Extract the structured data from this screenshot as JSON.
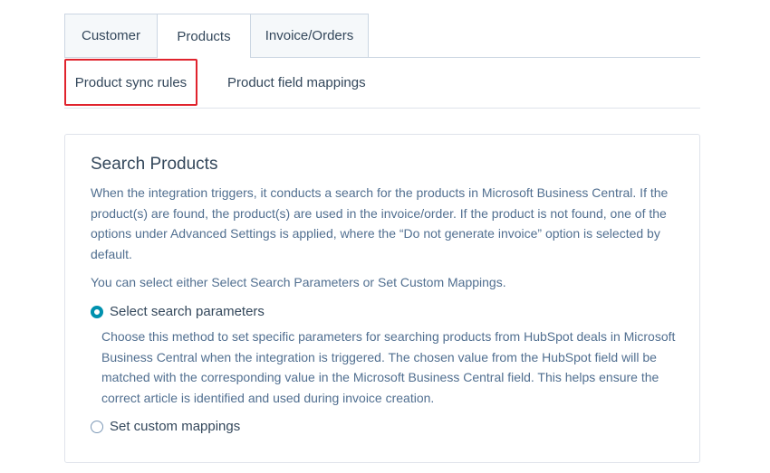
{
  "tabs": [
    {
      "label": "Customer",
      "active": false
    },
    {
      "label": "Products",
      "active": true
    },
    {
      "label": "Invoice/Orders",
      "active": false
    }
  ],
  "subtabs": [
    {
      "label": "Product sync rules",
      "active": true,
      "highlighted": true
    },
    {
      "label": "Product field mappings",
      "active": false
    }
  ],
  "panel": {
    "title": "Search Products",
    "description": "When the integration triggers, it conducts a search for the products in Microsoft Business Central. If the product(s) are found, the product(s) are used in the invoice/order. If the product is not found, one of the options under Advanced Settings is applied, where the “Do not generate invoice” option is selected by default.",
    "choose_text": "You can select either Select Search Parameters or Set Custom Mappings.",
    "options": [
      {
        "label": "Select search parameters",
        "selected": true,
        "description": "Choose this method to set specific parameters for searching products from HubSpot deals in Microsoft Business Central when the integration is triggered. The chosen value from the HubSpot field will be matched with the corresponding value in the Microsoft Business Central field. This helps ensure the correct article is identified and used during invoice creation."
      },
      {
        "label": "Set custom mappings",
        "selected": false
      }
    ]
  },
  "colors": {
    "highlight_border": "#e0232d",
    "radio_selected": "#0091ae",
    "text": "#33475b",
    "muted_text": "#516f90",
    "border": "#cbd6e2"
  }
}
